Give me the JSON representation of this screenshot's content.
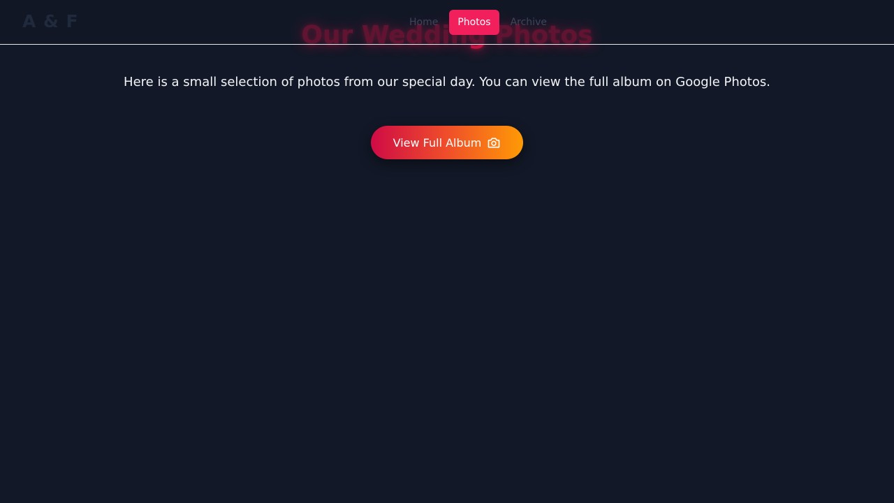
{
  "header": {
    "logo": "A & F",
    "nav": [
      {
        "label": "Home"
      },
      {
        "label": "Photos",
        "active": true
      },
      {
        "label": "Archive"
      }
    ]
  },
  "hero": {
    "title": "Our Wedding Photos",
    "description": "Here is a small selection of photos from our special day. You can view the full album on Google Photos."
  },
  "album_button": {
    "label": "View Full Album",
    "icon": "camera-icon"
  },
  "colors": {
    "background": "#121827",
    "accent": "#f21f5d",
    "gradient_start": "#cf0b45",
    "gradient_end": "#ff9a05"
  }
}
